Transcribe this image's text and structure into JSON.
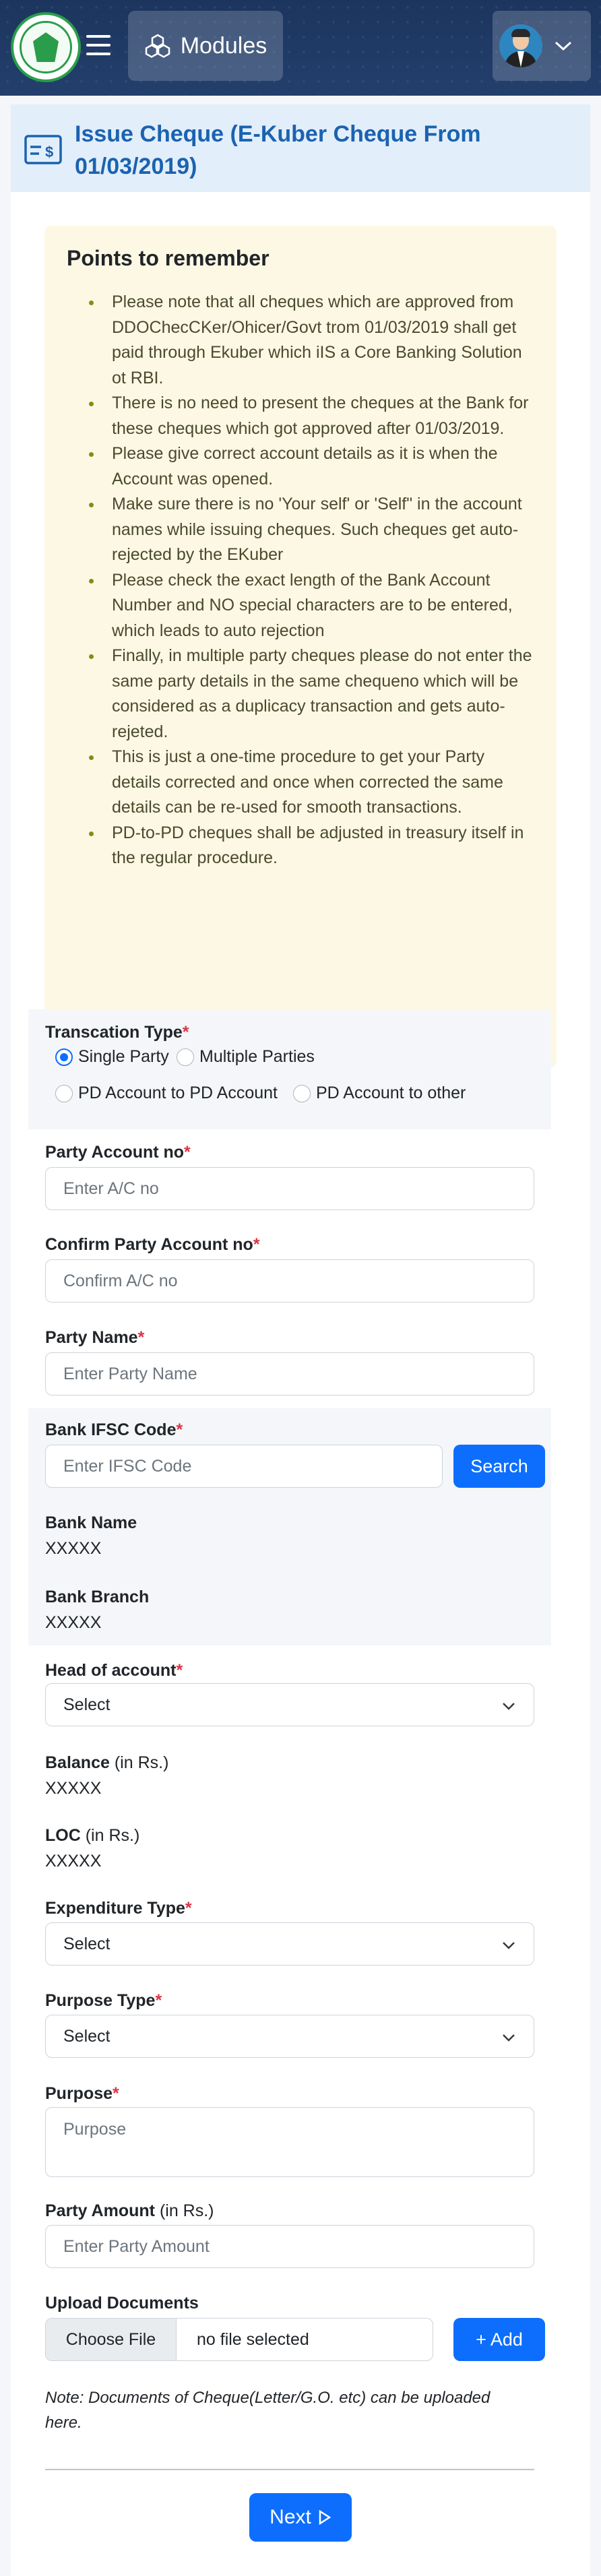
{
  "header": {
    "modules_label": "Modules"
  },
  "card": {
    "title": "Issue Cheque (E-Kuber Cheque From 01/03/2019)"
  },
  "points": {
    "heading": "Points to remember",
    "items": [
      "Please note that all cheques which are approved from DDOChecCKer/Ohicer/Govt trom 01/03/2019 shall get paid through Ekuber which iIS a Core Banking Solution ot RBI.",
      "There is no need to present the cheques at the Bank for these cheques which got approved after 01/03/2019.",
      "Please give correct account details as it is when the Account was opened.",
      "Make sure there is no 'Your self' or 'Self\" in the account names while issuing cheques. Such cheques get auto-rejected by the EKuber",
      "Please check the exact length of the Bank Account Number and NO special characters are to be entered, which leads to auto rejection",
      "Finally, in multiple party cheques please do not enter the same party details in the same chequeno which will be considered as a duplicacy transaction and gets auto-rejeted.",
      "This is just a one-time procedure to get your Party details corrected and once when corrected the same details can be re-used for smooth transactions.",
      "PD-to-PD cheques shall be adjusted in treasury itself in the regular procedure."
    ]
  },
  "form": {
    "transaction_type": {
      "label": "Transcation Type",
      "options": [
        "Single Party",
        "Multiple Parties",
        "PD Account to PD Account",
        "PD Account to other"
      ],
      "selected": "Single Party"
    },
    "party_account": {
      "label": "Party Account no",
      "placeholder": "Enter A/C no"
    },
    "confirm_party_account": {
      "label": "Confirm Party Account no",
      "placeholder": "Confirm A/C no"
    },
    "party_name": {
      "label": "Party Name",
      "placeholder": "Enter Party Name"
    },
    "ifsc": {
      "label": "Bank IFSC Code",
      "placeholder": "Enter IFSC Code",
      "search_label": "Search"
    },
    "bank_name": {
      "label": "Bank Name",
      "value": "XXXXX"
    },
    "bank_branch": {
      "label": "Bank Branch",
      "value": "XXXXX"
    },
    "head_of_account": {
      "label": "Head of account",
      "value": "Select"
    },
    "balance": {
      "label": "Balance",
      "unit": "(in Rs.)",
      "value": "XXXXX"
    },
    "loc": {
      "label": "LOC",
      "unit": "(in Rs.)",
      "value": "XXXXX"
    },
    "expenditure_type": {
      "label": "Expenditure Type",
      "value": "Select"
    },
    "purpose_type": {
      "label": "Purpose Type",
      "value": "Select"
    },
    "purpose": {
      "label": "Purpose",
      "placeholder": "Purpose"
    },
    "party_amount": {
      "label": "Party Amount",
      "unit": "(in Rs.)",
      "placeholder": "Enter Party Amount"
    },
    "upload": {
      "label": "Upload Documents",
      "choose_label": "Choose File",
      "status": "no file selected",
      "add_label": "+ Add",
      "note": "Note: Documents of Cheque(Letter/G.O. etc) can be uploaded here."
    },
    "next_label": "Next"
  },
  "colors": {
    "primary": "#0d6efd",
    "header_bg": "#1c355e",
    "title": "#1a63b0",
    "points_bg": "#fdf8e4",
    "required": "#dc3545"
  }
}
